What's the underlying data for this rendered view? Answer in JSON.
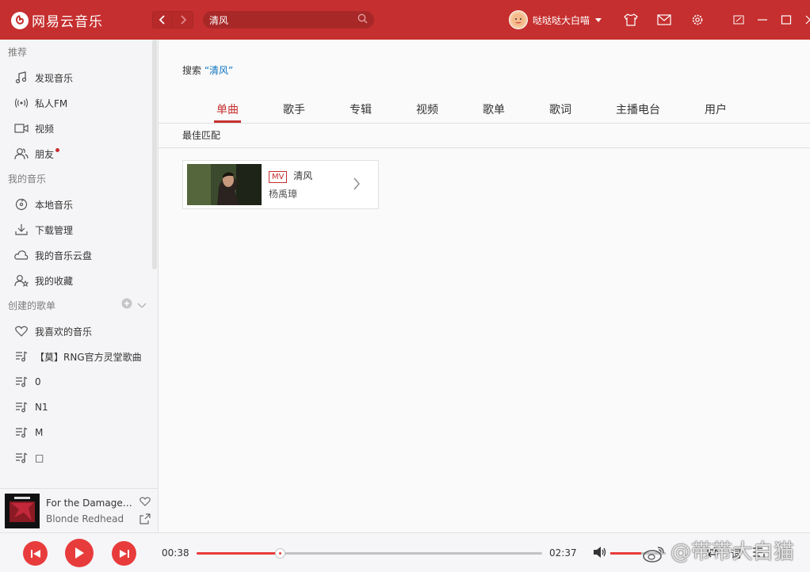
{
  "app": {
    "name": "网易云音乐",
    "accent": "#c62f2f"
  },
  "header": {
    "search_value": "清风",
    "user_name": "哒哒哒大白喵"
  },
  "sidebar": {
    "section_recommend": "推荐",
    "recommend_items": [
      {
        "label": "发现音乐",
        "icon": "music-note-icon"
      },
      {
        "label": "私人FM",
        "icon": "radio-icon"
      },
      {
        "label": "视频",
        "icon": "video-icon"
      },
      {
        "label": "朋友",
        "icon": "friends-icon"
      }
    ],
    "section_my_music": "我的音乐",
    "my_music_items": [
      {
        "label": "本地音乐",
        "icon": "local-music-icon"
      },
      {
        "label": "下载管理",
        "icon": "download-icon"
      },
      {
        "label": "我的音乐云盘",
        "icon": "cloud-icon"
      },
      {
        "label": "我的收藏",
        "icon": "collection-icon"
      }
    ],
    "section_created_playlists": "创建的歌单",
    "playlists": [
      {
        "label": "我喜欢的音乐",
        "icon": "heart-icon"
      },
      {
        "label": "【莫】RNG官方灵堂歌曲",
        "icon": "playlist-icon"
      },
      {
        "label": "0",
        "icon": "playlist-icon"
      },
      {
        "label": "N1",
        "icon": "playlist-icon"
      },
      {
        "label": "M",
        "icon": "playlist-icon"
      },
      {
        "label": "□",
        "icon": "playlist-icon"
      }
    ]
  },
  "now_playing": {
    "title": "For the Damaged Coda",
    "artist": "Blonde Redhead"
  },
  "main": {
    "search_prefix": "搜索",
    "search_keyword": "“清风”",
    "tabs": [
      "单曲",
      "歌手",
      "专辑",
      "视频",
      "歌单",
      "歌词",
      "主播电台",
      "用户"
    ],
    "active_tab": "单曲",
    "best_match_label": "最佳匹配",
    "best_match": {
      "badge": "MV",
      "title": "清风",
      "artist": "杨禹璋"
    }
  },
  "player": {
    "current_time": "00:38",
    "total_time": "02:37",
    "progress": 0.241,
    "volume": 0.55,
    "lyrics_label": "词"
  },
  "watermark": "@带带大白猫"
}
